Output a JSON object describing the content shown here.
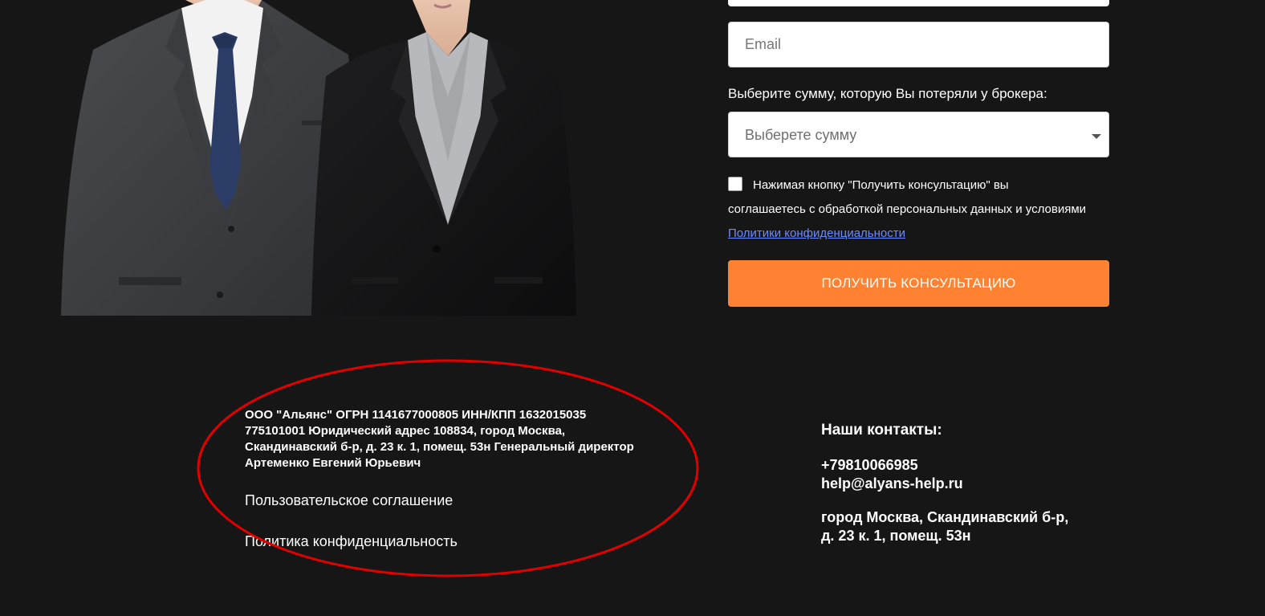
{
  "form": {
    "email_placeholder": "Email",
    "amount_label": "Выберите сумму, которую Вы потеряли у брокера:",
    "amount_select_value": "Выберете сумму",
    "consent_line_1": "Нажимая кнопку \"Получить консультацию\" вы",
    "consent_line_2": "соглашаетесь с обработкой персональных данных и условиями",
    "consent_link": "Политики конфиденциальности",
    "consent_checked": false,
    "submit_label": "ПОЛУЧИТЬ КОНСУЛЬТАЦИЮ"
  },
  "footer": {
    "company_info": "ООО \"Альянс\" ОГРН 1141677000805 ИНН/КПП 1632015035 775101001 Юридический адрес 108834, город Москва, Скандинавский б-р, д. 23 к. 1, помещ. 53н Генеральный директор Артеменко Евгений Юрьевич",
    "user_agreement_link": "Пользовательское соглашение",
    "privacy_policy_link": "Политика конфиденциальность",
    "contacts": {
      "title": "Наши контакты:",
      "phone": "+79810066985",
      "email": "help@alyans-help.ru",
      "address_line_1": "город Москва, Скандинавский б-р,",
      "address_line_2": "д. 23 к. 1, помещ. 53н"
    }
  },
  "colors": {
    "background": "#161616",
    "accent_button": "#ff8232",
    "link": "#6b8cff",
    "annotation_ellipse": "#e00000"
  },
  "icons": {
    "select_arrow": "chevron-down-icon"
  }
}
